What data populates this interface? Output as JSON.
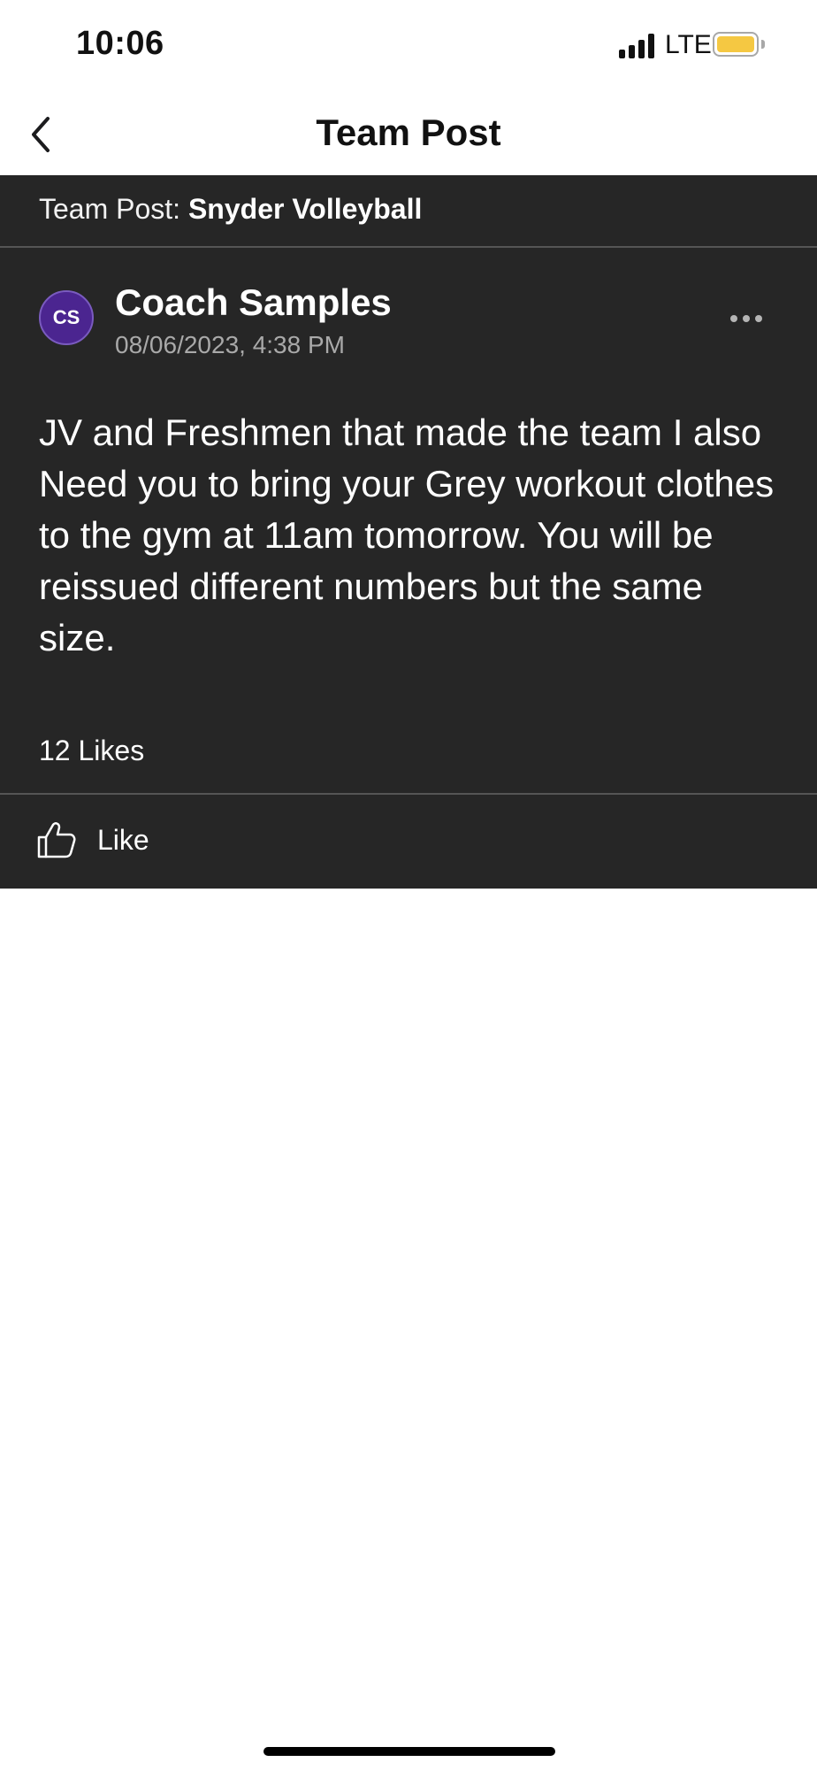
{
  "status_bar": {
    "time": "10:06",
    "network": "LTE",
    "battery_color": "#f5c842"
  },
  "nav": {
    "back_icon": "chevron-left-icon",
    "title": "Team Post"
  },
  "team_header": {
    "prefix": "Team Post: ",
    "team_name": "Snyder Volleyball"
  },
  "post": {
    "author_initials": "CS",
    "avatar_color": "#4b2590",
    "author_name": "Coach Samples",
    "timestamp": "08/06/2023, 4:38 PM",
    "more_icon": "ellipsis-icon",
    "body": "JV and Freshmen that made the team I also Need you to bring your Grey workout clothes to the gym at 11am tomorrow. You will be reissued different numbers but the same size.",
    "likes_count": "12 Likes",
    "like_icon": "thumbs-up-icon",
    "like_label": "Like"
  }
}
